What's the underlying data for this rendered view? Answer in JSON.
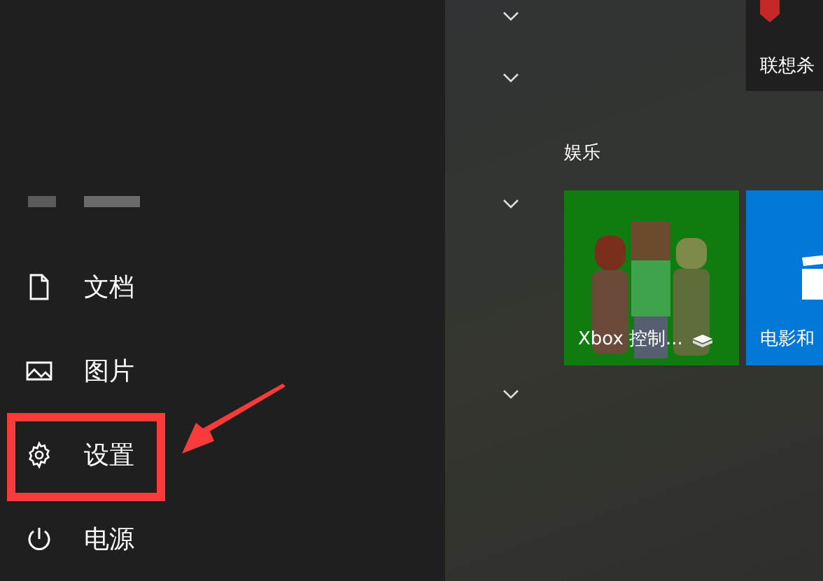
{
  "nav_items": [
    {
      "kind": "documents",
      "label": "文档",
      "annotated": false
    },
    {
      "kind": "pictures",
      "label": "图片",
      "annotated": false
    },
    {
      "kind": "settings",
      "label": "设置",
      "annotated": true
    },
    {
      "kind": "power",
      "label": "电源",
      "annotated": false
    }
  ],
  "top_tile": {
    "label": "联想杀"
  },
  "group": {
    "title": "娱乐"
  },
  "tiles": [
    {
      "kind": "xbox",
      "label": "Xbox 控制..."
    },
    {
      "kind": "movies",
      "label": "电影和"
    }
  ]
}
